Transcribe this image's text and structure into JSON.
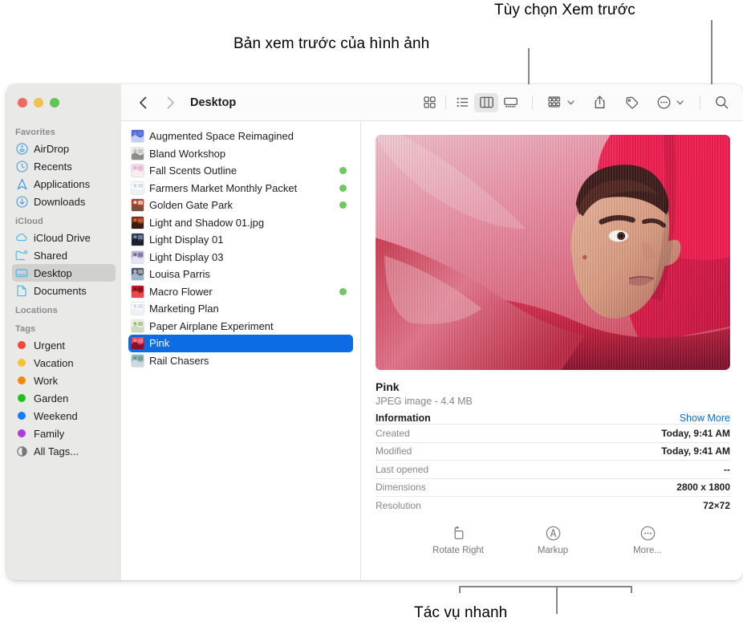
{
  "callouts": {
    "preview_options": "Tùy chọn Xem trước",
    "image_preview": "Bản xem trước của hình ảnh",
    "quick_actions": "Tác vụ nhanh"
  },
  "window": {
    "traffic_lights": [
      "close-button",
      "minimize-button",
      "zoom-button"
    ],
    "colors": {
      "close": "#ed6a5e",
      "minimize": "#f4bf4f",
      "zoom": "#61c554",
      "accent": "#0b6ce4",
      "tag_green": "#6ccb5f",
      "link": "#0a6ce0"
    }
  },
  "toolbar": {
    "back_label": "‹",
    "forward_label": "›",
    "breadcrumb": "Desktop",
    "view_buttons": [
      {
        "name": "icon-view",
        "active": false
      },
      {
        "name": "list-view",
        "active": false
      },
      {
        "name": "column-view",
        "active": true
      },
      {
        "name": "gallery-view",
        "active": false
      }
    ],
    "actions": [
      {
        "name": "group-by-button"
      },
      {
        "name": "share-button"
      },
      {
        "name": "tag-button"
      },
      {
        "name": "more-actions-button"
      }
    ],
    "search": {
      "name": "search-button"
    }
  },
  "sidebar": {
    "sections": [
      {
        "title": "Favorites",
        "items": [
          {
            "label": "AirDrop",
            "icon": "airdrop-icon",
            "selected": false
          },
          {
            "label": "Recents",
            "icon": "clock-icon",
            "selected": false
          },
          {
            "label": "Applications",
            "icon": "applications-icon",
            "selected": false
          },
          {
            "label": "Downloads",
            "icon": "downloads-icon",
            "selected": false
          }
        ]
      },
      {
        "title": "iCloud",
        "items": [
          {
            "label": "iCloud Drive",
            "icon": "cloud-icon",
            "selected": false
          },
          {
            "label": "Shared",
            "icon": "shared-folder-icon",
            "selected": false
          },
          {
            "label": "Desktop",
            "icon": "desktop-icon",
            "selected": true
          },
          {
            "label": "Documents",
            "icon": "document-icon",
            "selected": false
          }
        ]
      },
      {
        "title": "Locations",
        "items": []
      },
      {
        "title": "Tags",
        "items": [
          {
            "label": "Urgent",
            "icon": "tag-dot-icon",
            "color": "#f8453a",
            "selected": false
          },
          {
            "label": "Vacation",
            "icon": "tag-dot-icon",
            "color": "#fbc02e",
            "selected": false
          },
          {
            "label": "Work",
            "icon": "tag-dot-icon",
            "color": "#ef8b0b",
            "selected": false
          },
          {
            "label": "Garden",
            "icon": "tag-dot-icon",
            "color": "#20c020",
            "selected": false
          },
          {
            "label": "Weekend",
            "icon": "tag-dot-icon",
            "color": "#147dfb",
            "selected": false
          },
          {
            "label": "Family",
            "icon": "tag-dot-icon",
            "color": "#a93cd8",
            "selected": false
          },
          {
            "label": "All Tags...",
            "icon": "all-tags-icon",
            "color": "",
            "selected": false
          }
        ]
      }
    ]
  },
  "filelist": {
    "items": [
      {
        "name": "Augmented Space Reimagined",
        "tag": "",
        "selected": false,
        "thumb": [
          "#4f62d8",
          "#6f86e6",
          "#c3cff5"
        ]
      },
      {
        "name": "Bland Workshop",
        "tag": "",
        "selected": false,
        "thumb": [
          "#e8e8e6",
          "#b9b9b6",
          "#8c8c8a"
        ]
      },
      {
        "name": "Fall Scents Outline",
        "tag": "#6ccb5f",
        "selected": false,
        "thumb": [
          "#f2d8e6",
          "#e8aecd",
          "#f7eef4"
        ]
      },
      {
        "name": "Farmers Market Monthly Packet",
        "tag": "#6ccb5f",
        "selected": false,
        "thumb": [
          "#ffffff",
          "#c8d6e6",
          "#eef2f7"
        ]
      },
      {
        "name": "Golden Gate Park",
        "tag": "#6ccb5f",
        "selected": false,
        "thumb": [
          "#c0392b",
          "#e8e2d4",
          "#7b4f3a"
        ]
      },
      {
        "name": "Light and Shadow 01.jpg",
        "tag": "",
        "selected": false,
        "thumb": [
          "#7a2f1c",
          "#d96a3a",
          "#3b1a10"
        ]
      },
      {
        "name": "Light Display 01",
        "tag": "",
        "selected": false,
        "thumb": [
          "#2f3b4f",
          "#7d8fa3",
          "#1b222e"
        ]
      },
      {
        "name": "Light Display 03",
        "tag": "",
        "selected": false,
        "thumb": [
          "#b9b4d6",
          "#6f6a93",
          "#e6e3f2"
        ]
      },
      {
        "name": "Louisa Parris",
        "tag": "",
        "selected": false,
        "thumb": [
          "#3a5a8c",
          "#d8b48a",
          "#9fb4cf"
        ]
      },
      {
        "name": "Macro Flower",
        "tag": "#6ccb5f",
        "selected": false,
        "thumb": [
          "#c0182a",
          "#7a0f1c",
          "#e84a4a"
        ]
      },
      {
        "name": "Marketing Plan",
        "tag": "",
        "selected": false,
        "thumb": [
          "#ffffff",
          "#c8d6e6",
          "#eef2f7"
        ]
      },
      {
        "name": "Paper Airplane Experiment",
        "tag": "",
        "selected": false,
        "thumb": [
          "#eef0e8",
          "#9dbb6a",
          "#cfd9c0"
        ]
      },
      {
        "name": "Pink",
        "tag": "",
        "selected": true,
        "thumb": [
          "#e8435f",
          "#f07f95",
          "#8c0f28"
        ]
      },
      {
        "name": "Rail Chasers",
        "tag": "",
        "selected": false,
        "thumb": [
          "#8fb8cf",
          "#6f9b6a",
          "#cfd8dd"
        ]
      }
    ]
  },
  "preview": {
    "image_name": "portrait-pink-fabric",
    "title": "Pink",
    "subtitle": "JPEG image - 4.4 MB",
    "information_label": "Information",
    "show_more_label": "Show More",
    "rows": [
      {
        "key": "Created",
        "value": "Today, 9:41 AM"
      },
      {
        "key": "Modified",
        "value": "Today, 9:41 AM"
      },
      {
        "key": "Last opened",
        "value": "--"
      },
      {
        "key": "Dimensions",
        "value": "2800 x 1800"
      },
      {
        "key": "Resolution",
        "value": "72×72"
      }
    ],
    "quick_actions": [
      {
        "label": "Rotate Right",
        "icon": "rotate-right-icon"
      },
      {
        "label": "Markup",
        "icon": "markup-icon"
      },
      {
        "label": "More...",
        "icon": "more-icon"
      }
    ]
  }
}
